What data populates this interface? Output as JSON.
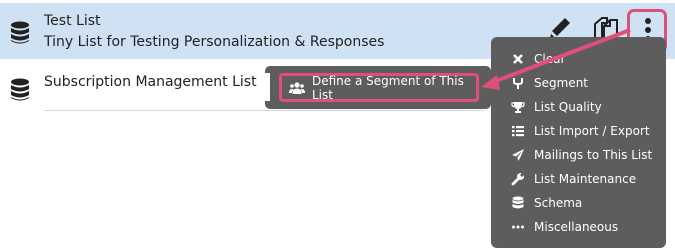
{
  "lists": [
    {
      "title": "Test List",
      "description": "Tiny List for Testing Personalization & Responses"
    },
    {
      "title": "Subscription Management List"
    }
  ],
  "toolbar": {
    "edit_icon": "pencil-icon",
    "copy_icon": "copy-icon",
    "more_icon": "vertical-dots-icon"
  },
  "menu": {
    "items": [
      {
        "label": "Clear",
        "icon": "x-icon"
      },
      {
        "label": "Segment",
        "icon": "fork-icon"
      },
      {
        "label": "List Quality",
        "icon": "trophy-icon"
      },
      {
        "label": "List Import / Export",
        "icon": "list-icon"
      },
      {
        "label": "Mailings to This List",
        "icon": "send-icon"
      },
      {
        "label": "List Maintenance",
        "icon": "wrench-icon"
      },
      {
        "label": "Schema",
        "icon": "database-icon"
      },
      {
        "label": "Miscellaneous",
        "icon": "ellipsis-icon"
      }
    ]
  },
  "submenu": {
    "action_label": "Define a Segment of This List",
    "icon": "users-icon"
  },
  "colors": {
    "highlight": "#e04f7a",
    "menu_bg": "#5d5d5d",
    "selected_row": "#cfe2f3"
  }
}
